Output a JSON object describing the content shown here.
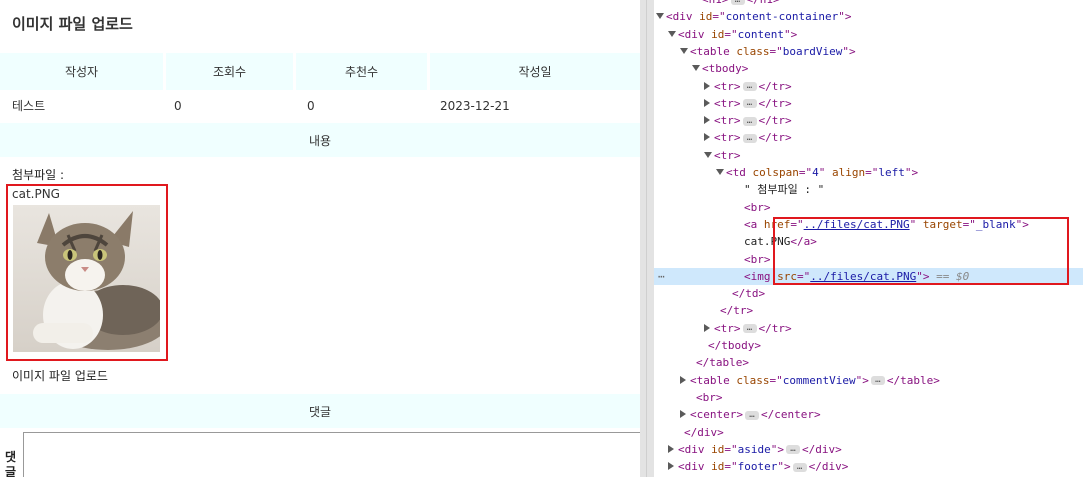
{
  "page": {
    "title": "이미지 파일 업로드",
    "headers": [
      "작성자",
      "조회수",
      "추천수",
      "작성일"
    ],
    "values": [
      "테스트",
      "0",
      "0",
      "2023-12-21"
    ],
    "content_header": "내용",
    "attachment_label": "첨부파일 :",
    "file_link": "cat.PNG",
    "body_text": "이미지 파일 업로드",
    "comment_header": "댓글",
    "comment_label": "댓글"
  },
  "devtools": {
    "lines": [
      {
        "indent": 6,
        "tri": "",
        "parts": [
          [
            "tg",
            "<h1>"
          ],
          [
            "ell",
            ""
          ],
          [
            "tg",
            "</h1>"
          ]
        ]
      },
      {
        "indent": 3,
        "tri": "down",
        "parts": [
          [
            "tg",
            "<div "
          ],
          [
            "an",
            "id"
          ],
          [
            "tg",
            "=\""
          ],
          [
            "av",
            "content-container"
          ],
          [
            "tg",
            "\">"
          ]
        ]
      },
      {
        "indent": 4,
        "tri": "down",
        "parts": [
          [
            "tg",
            "<div "
          ],
          [
            "an",
            "id"
          ],
          [
            "tg",
            "=\""
          ],
          [
            "av",
            "content"
          ],
          [
            "tg",
            "\">"
          ]
        ]
      },
      {
        "indent": 5,
        "tri": "down",
        "parts": [
          [
            "tg",
            "<table "
          ],
          [
            "an",
            "class"
          ],
          [
            "tg",
            "=\""
          ],
          [
            "av",
            "boardView"
          ],
          [
            "tg",
            "\">"
          ]
        ]
      },
      {
        "indent": 6,
        "tri": "down",
        "parts": [
          [
            "tg",
            "<tbody>"
          ]
        ]
      },
      {
        "indent": 7,
        "tri": "right",
        "parts": [
          [
            "tg",
            "<tr>"
          ],
          [
            "ell",
            ""
          ],
          [
            "tg",
            "</tr>"
          ]
        ]
      },
      {
        "indent": 7,
        "tri": "right",
        "parts": [
          [
            "tg",
            "<tr>"
          ],
          [
            "ell",
            ""
          ],
          [
            "tg",
            "</tr>"
          ]
        ]
      },
      {
        "indent": 7,
        "tri": "right",
        "parts": [
          [
            "tg",
            "<tr>"
          ],
          [
            "ell",
            ""
          ],
          [
            "tg",
            "</tr>"
          ]
        ]
      },
      {
        "indent": 7,
        "tri": "right",
        "parts": [
          [
            "tg",
            "<tr>"
          ],
          [
            "ell",
            ""
          ],
          [
            "tg",
            "</tr>"
          ]
        ]
      },
      {
        "indent": 7,
        "tri": "down",
        "parts": [
          [
            "tg",
            "<tr>"
          ]
        ]
      },
      {
        "indent": 8,
        "tri": "down",
        "parts": [
          [
            "tg",
            "<td "
          ],
          [
            "an",
            "colspan"
          ],
          [
            "tg",
            "=\""
          ],
          [
            "av",
            "4"
          ],
          [
            "tg",
            "\" "
          ],
          [
            "an",
            "align"
          ],
          [
            "tg",
            "=\""
          ],
          [
            "av",
            "left"
          ],
          [
            "tg",
            "\">"
          ]
        ]
      },
      {
        "indent": 9.5,
        "tri": "",
        "parts": [
          [
            "tx",
            "\" 첨부파일 : \""
          ]
        ]
      },
      {
        "indent": 9.5,
        "tri": "",
        "parts": [
          [
            "tg",
            "<br>"
          ]
        ]
      },
      {
        "indent": 9.5,
        "tri": "",
        "parts": [
          [
            "tg",
            "<a "
          ],
          [
            "an",
            "href"
          ],
          [
            "tg",
            "=\""
          ],
          [
            "lk",
            "../files/cat.PNG"
          ],
          [
            "tg",
            "\" "
          ],
          [
            "an",
            "target"
          ],
          [
            "tg",
            "=\""
          ],
          [
            "av",
            "_blank"
          ],
          [
            "tg",
            "\">"
          ]
        ]
      },
      {
        "indent": 9.5,
        "tri": "",
        "parts": [
          [
            "tx",
            "cat.PNG"
          ],
          [
            "tg",
            "</a>"
          ]
        ]
      },
      {
        "indent": 9.5,
        "tri": "",
        "parts": [
          [
            "tg",
            "<br>"
          ]
        ]
      },
      {
        "indent": 9.5,
        "tri": "",
        "sel": true,
        "parts": [
          [
            "tg",
            "<img "
          ],
          [
            "an",
            "src"
          ],
          [
            "tg",
            "=\""
          ],
          [
            "lk",
            "../files/cat.PNG"
          ],
          [
            "tg",
            "\">"
          ],
          [
            "dim",
            " == $0"
          ]
        ]
      },
      {
        "indent": 8.5,
        "tri": "",
        "parts": [
          [
            "tg",
            "</td>"
          ]
        ]
      },
      {
        "indent": 7.5,
        "tri": "",
        "parts": [
          [
            "tg",
            "</tr>"
          ]
        ]
      },
      {
        "indent": 7,
        "tri": "right",
        "parts": [
          [
            "tg",
            "<tr>"
          ],
          [
            "ell",
            ""
          ],
          [
            "tg",
            "</tr>"
          ]
        ]
      },
      {
        "indent": 6.5,
        "tri": "",
        "parts": [
          [
            "tg",
            "</tbody>"
          ]
        ]
      },
      {
        "indent": 5.5,
        "tri": "",
        "parts": [
          [
            "tg",
            "</table>"
          ]
        ]
      },
      {
        "indent": 5,
        "tri": "right",
        "parts": [
          [
            "tg",
            "<table "
          ],
          [
            "an",
            "class"
          ],
          [
            "tg",
            "=\""
          ],
          [
            "av",
            "commentView"
          ],
          [
            "tg",
            "\">"
          ],
          [
            "ell",
            ""
          ],
          [
            "tg",
            "</table>"
          ]
        ]
      },
      {
        "indent": 5.5,
        "tri": "",
        "parts": [
          [
            "tg",
            "<br>"
          ]
        ]
      },
      {
        "indent": 5,
        "tri": "right",
        "parts": [
          [
            "tg",
            "<center>"
          ],
          [
            "ell",
            ""
          ],
          [
            "tg",
            "</center>"
          ]
        ]
      },
      {
        "indent": 4.5,
        "tri": "",
        "parts": [
          [
            "tg",
            "</div>"
          ]
        ]
      },
      {
        "indent": 4,
        "tri": "right",
        "parts": [
          [
            "tg",
            "<div "
          ],
          [
            "an",
            "id"
          ],
          [
            "tg",
            "=\""
          ],
          [
            "av",
            "aside"
          ],
          [
            "tg",
            "\">"
          ],
          [
            "ell",
            ""
          ],
          [
            "tg",
            "</div>"
          ]
        ]
      },
      {
        "indent": 4,
        "tri": "right",
        "parts": [
          [
            "tg",
            "<div "
          ],
          [
            "an",
            "id"
          ],
          [
            "tg",
            "=\""
          ],
          [
            "av",
            "footer"
          ],
          [
            "tg",
            "\">"
          ],
          [
            "ell",
            ""
          ],
          [
            "tg",
            "</div>"
          ]
        ]
      }
    ],
    "gutter_dots": "⋯"
  },
  "colors": {
    "highlight_border": "#e0181e",
    "table_band": "#f0ffff",
    "selected_line": "#cfe8fc"
  }
}
